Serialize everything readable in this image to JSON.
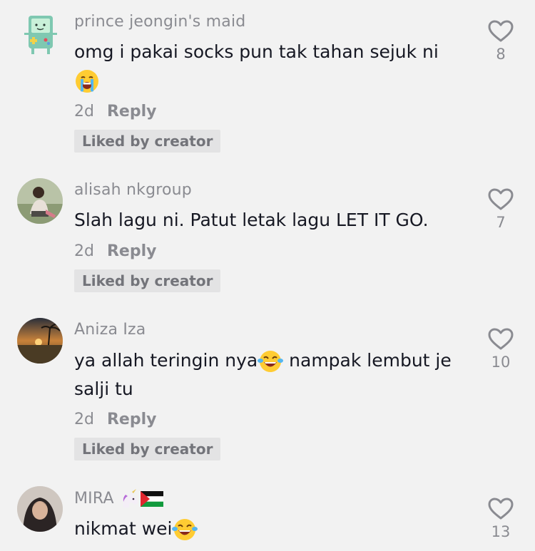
{
  "comments": [
    {
      "username": "prince jeongin's maid",
      "text": "omg i pakai socks pun tak tahan sejuk ni",
      "emoji": "crying-face",
      "age": "2d",
      "reply_label": "Reply",
      "liked_label": "Liked by creator",
      "likes": "8"
    },
    {
      "username": "alisah nkgroup",
      "text": "Slah lagu ni. Patut letak lagu LET IT GO.",
      "age": "2d",
      "reply_label": "Reply",
      "liked_label": "Liked by creator",
      "likes": "7"
    },
    {
      "username": "Aniza Iza",
      "text_before": "ya allah teringin nya",
      "emoji": "tears-of-joy",
      "text_after": " nampak lembut je salji tu",
      "age": "2d",
      "reply_label": "Reply",
      "liked_label": "Liked by creator",
      "likes": "10"
    },
    {
      "username": "MIRA",
      "username_emojis": [
        "unicorn",
        "palestine-flag"
      ],
      "text": "nikmat wei",
      "emoji": "tears-of-joy",
      "likes": "13"
    }
  ]
}
